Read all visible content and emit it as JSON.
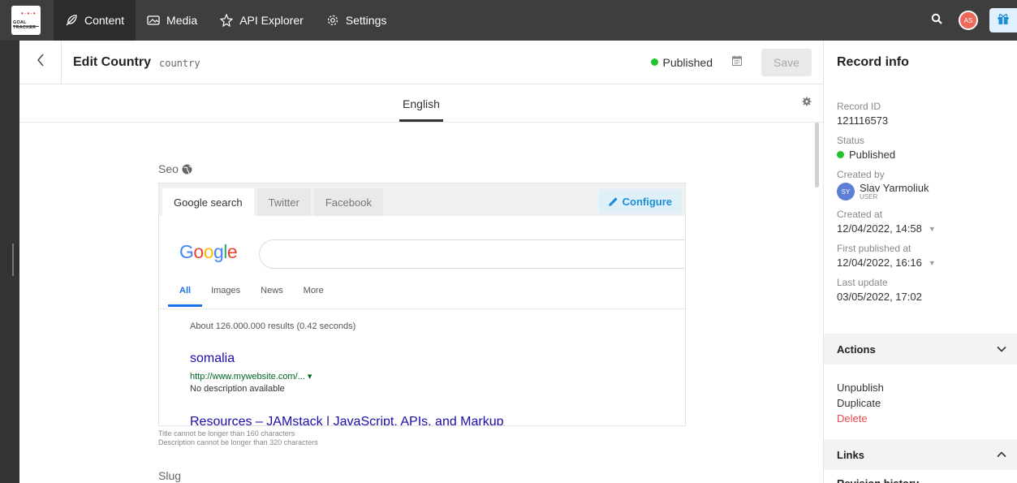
{
  "topbar": {
    "logo_text": "GOAL TRACKER",
    "nav": [
      {
        "label": "Content",
        "icon": "feather-icon"
      },
      {
        "label": "Media",
        "icon": "image-icon"
      },
      {
        "label": "API Explorer",
        "icon": "api-icon"
      },
      {
        "label": "Settings",
        "icon": "gear-icon"
      }
    ],
    "user_initials": "AS"
  },
  "editor": {
    "title": "Edit Country",
    "api_key": "country",
    "status": "Published",
    "save_label": "Save",
    "locale": "English"
  },
  "seo": {
    "label": "Seo",
    "tabs": [
      "Google search",
      "Twitter",
      "Facebook"
    ],
    "configure_label": "Configure",
    "google_logo": "Google",
    "google_tabs": [
      "All",
      "Images",
      "News",
      "More"
    ],
    "stats": "About 126.000.000 results (0.42 seconds)",
    "result_title": "somalia",
    "result_url": "http://www.mywebsite.com/... ▾",
    "result_desc": "No description available",
    "result2_title": "Resources – JAMstack | JavaScript, APIs, and Markup",
    "hint_title": "Title cannot be longer than 160 characters",
    "hint_desc": "Description cannot be longer than 320 characters"
  },
  "slug": {
    "label": "Slug"
  },
  "sidebar": {
    "title": "Record info",
    "record_id_label": "Record ID",
    "record_id": "121116573",
    "status_label": "Status",
    "status": "Published",
    "created_by_label": "Created by",
    "creator_initials": "SY",
    "creator_name": "Slav Yarmoliuk",
    "creator_role": "USER",
    "created_at_label": "Created at",
    "created_at": "12/04/2022, 14:58",
    "first_published_label": "First published at",
    "first_published": "12/04/2022, 16:16",
    "last_update_label": "Last update",
    "last_update": "03/05/2022, 17:02",
    "actions_label": "Actions",
    "actions": [
      "Unpublish",
      "Duplicate",
      "Delete"
    ],
    "links_label": "Links",
    "cut_section": "Revision history"
  },
  "colors": {
    "published": "#21c22a",
    "danger": "#e5484d",
    "accent": "#1a8fd8"
  }
}
